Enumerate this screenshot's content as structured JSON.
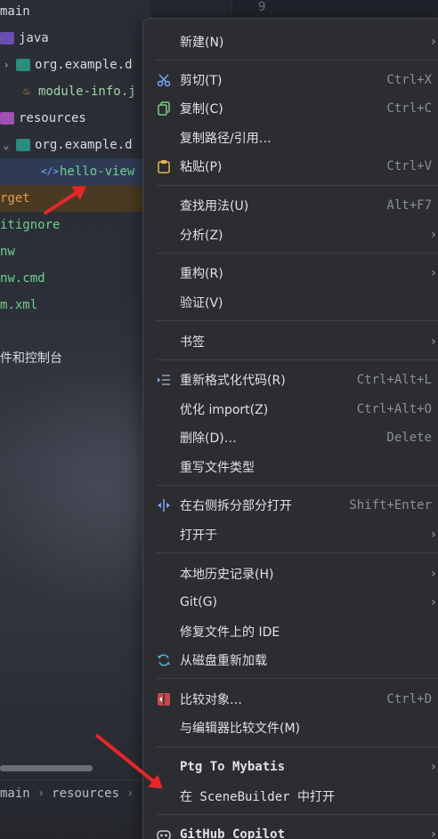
{
  "tree": {
    "items": [
      {
        "label": "main"
      },
      {
        "label": "java"
      },
      {
        "label": "org.example.d"
      },
      {
        "label": "module-info.j"
      },
      {
        "label": "resources"
      },
      {
        "label": "org.example.d"
      },
      {
        "label": "hello-view"
      },
      {
        "label": "rget"
      },
      {
        "label": "itignore"
      },
      {
        "label": "nw"
      },
      {
        "label": "nw.cmd"
      },
      {
        "label": "m.xml"
      },
      {
        "label": "件和控制台"
      }
    ]
  },
  "editor": {
    "line_number": "9"
  },
  "breadcrumb": {
    "items": [
      "main",
      "resources"
    ]
  },
  "menu": {
    "items": [
      {
        "label": "新建(N)",
        "shortcut": "",
        "submenu": true
      },
      {
        "label": "剪切(T)",
        "shortcut": "Ctrl+X"
      },
      {
        "label": "复制(C)",
        "shortcut": "Ctrl+C"
      },
      {
        "label": "复制路径/引用…",
        "shortcut": ""
      },
      {
        "label": "粘贴(P)",
        "shortcut": "Ctrl+V"
      },
      {
        "label": "查找用法(U)",
        "shortcut": "Alt+F7"
      },
      {
        "label": "分析(Z)",
        "shortcut": "",
        "submenu": true
      },
      {
        "label": "重构(R)",
        "shortcut": "",
        "submenu": true
      },
      {
        "label": "验证(V)",
        "shortcut": ""
      },
      {
        "label": "书签",
        "shortcut": "",
        "submenu": true
      },
      {
        "label": "重新格式化代码(R)",
        "shortcut": "Ctrl+Alt+L"
      },
      {
        "label": "优化 import(Z)",
        "shortcut": "Ctrl+Alt+O"
      },
      {
        "label": "删除(D)…",
        "shortcut": "Delete"
      },
      {
        "label": "重写文件类型",
        "shortcut": ""
      },
      {
        "label": "在右侧拆分部分打开",
        "shortcut": "Shift+Enter"
      },
      {
        "label": "打开于",
        "shortcut": "",
        "submenu": true
      },
      {
        "label": "本地历史记录(H)",
        "shortcut": "",
        "submenu": true
      },
      {
        "label": "Git(G)",
        "shortcut": "",
        "submenu": true
      },
      {
        "label": "修复文件上的 IDE",
        "shortcut": ""
      },
      {
        "label": "从磁盘重新加载",
        "shortcut": ""
      },
      {
        "label": "比较对象…",
        "shortcut": "Ctrl+D"
      },
      {
        "label": "与编辑器比较文件(M)",
        "shortcut": ""
      },
      {
        "label": "Ptg To Mybatis",
        "shortcut": "",
        "submenu": true
      },
      {
        "label": "在 SceneBuilder 中打开",
        "shortcut": ""
      },
      {
        "label": "GitHub Copilot",
        "shortcut": "",
        "submenu": true
      }
    ],
    "submenu_glyph": "›"
  },
  "colors": {
    "menu_bg": "#2b2d30",
    "accent_arrow": "#e8262a",
    "selected_row": "#2f3b55"
  }
}
